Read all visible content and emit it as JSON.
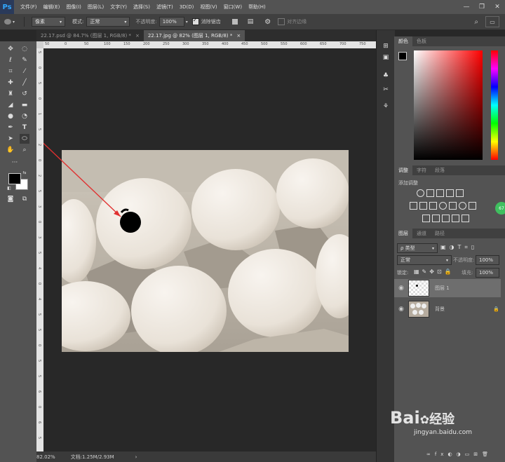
{
  "app": {
    "logo": "Ps"
  },
  "menubar": {
    "items": [
      "文件(F)",
      "编辑(E)",
      "图像(I)",
      "图层(L)",
      "文字(Y)",
      "选择(S)",
      "滤镜(T)",
      "3D(D)",
      "视图(V)",
      "窗口(W)",
      "帮助(H)"
    ]
  },
  "window_controls": {
    "minimize": "—",
    "restore": "❐",
    "close": "✕"
  },
  "options": {
    "size_mode": "像素",
    "mode_label": "模式:",
    "mode_value": "正常",
    "opacity_label": "不透明度:",
    "opacity_value": "100%",
    "antialias_label": "消除锯齿",
    "align_edges_label": "对齐边缘"
  },
  "tabs": [
    {
      "label": "22.17.psd @ 84.7% (图层 1, RGB/8) *",
      "close": "×",
      "active": false
    },
    {
      "label": "22.17.jpg @ 82% (图层 1, RGB/8) *",
      "close": "×",
      "active": true
    }
  ],
  "ruler": {
    "h_ticks": [
      "50",
      "0",
      "50",
      "100",
      "150",
      "200",
      "250",
      "300",
      "350",
      "400",
      "450",
      "500",
      "550",
      "600",
      "650",
      "700",
      "750"
    ],
    "v_ticks": [
      "5",
      "0",
      "5",
      "0",
      "1",
      "5",
      "2",
      "0",
      "2",
      "5",
      "3",
      "0",
      "3",
      "5",
      "4",
      "0",
      "4",
      "5",
      "5",
      "0",
      "5",
      "5",
      "6",
      "0",
      "6",
      "5"
    ]
  },
  "status": {
    "zoom": "82.02%",
    "doc": "文档:1.25M/2.93M",
    "arrow": "›"
  },
  "color_panel": {
    "tabs": [
      "颜色",
      "色板"
    ],
    "foreground": "#000000",
    "background": "#ffffff"
  },
  "adjust_panel": {
    "tabs": [
      "调整",
      "字符",
      "段落"
    ],
    "title": "添加调整"
  },
  "layers_panel": {
    "tabs": [
      "图层",
      "通道",
      "路径"
    ],
    "filter_kind": "ρ 类型",
    "blend_mode": "正常",
    "opacity_label": "不透明度:",
    "opacity_value": "100%",
    "lock_label": "锁定:",
    "fill_label": "填充:",
    "fill_value": "100%",
    "layers": [
      {
        "name": "图层 1",
        "selected": true,
        "visible": true
      },
      {
        "name": "背景",
        "selected": false,
        "visible": true,
        "locked": true
      }
    ]
  },
  "side_badge": "67",
  "watermark": {
    "brand": "Bai",
    "brand2": "经验",
    "url": "jingyan.baidu.com"
  },
  "colors": {
    "accent": "#31a8ff",
    "arrow": "#e03030",
    "spectrum_left": "#ff3b3b"
  }
}
